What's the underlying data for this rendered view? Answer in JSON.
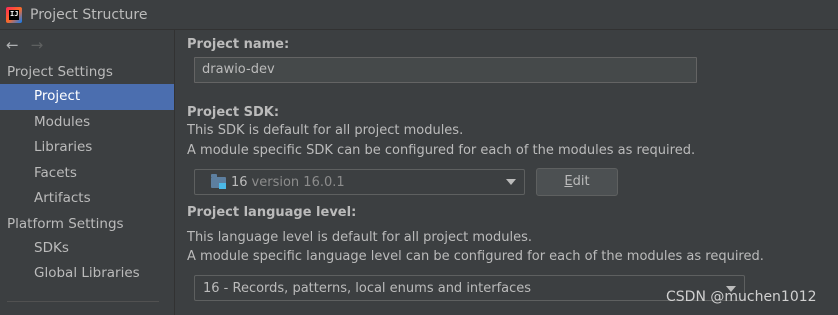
{
  "window": {
    "title": "Project Structure",
    "icon": "intellij-idea-icon"
  },
  "nav": {
    "back": "←",
    "forward": "→"
  },
  "sidebar": {
    "project_settings_header": "Project Settings",
    "project_settings_items": [
      {
        "label": "Project",
        "selected": true
      },
      {
        "label": "Modules"
      },
      {
        "label": "Libraries"
      },
      {
        "label": "Facets"
      },
      {
        "label": "Artifacts"
      }
    ],
    "platform_settings_header": "Platform Settings",
    "platform_settings_items": [
      {
        "label": "SDKs"
      },
      {
        "label": "Global Libraries"
      }
    ]
  },
  "main": {
    "project_name_label": "Project name:",
    "project_name_value": "drawio-dev",
    "sdk_label": "Project SDK:",
    "sdk_desc_1": "This SDK is default for all project modules.",
    "sdk_desc_2": "A module specific SDK can be configured for each of the modules as required.",
    "sdk_selected_name": "16",
    "sdk_selected_version": "version 16.0.1",
    "edit_button_mnemonic": "E",
    "edit_button_rest": "dit",
    "language_level_label": "Project language level:",
    "level_desc_1": "This language level is default for all project modules.",
    "level_desc_2": "A module specific language level can be configured for each of the modules as required.",
    "language_level_value": "16 - Records, patterns, local enums and interfaces"
  },
  "watermark": "CSDN @muchen1012",
  "colors": {
    "background": "#3c3f41",
    "selection": "#4b6eaf",
    "text": "#bbbbbb",
    "input_bg": "#45494a"
  }
}
